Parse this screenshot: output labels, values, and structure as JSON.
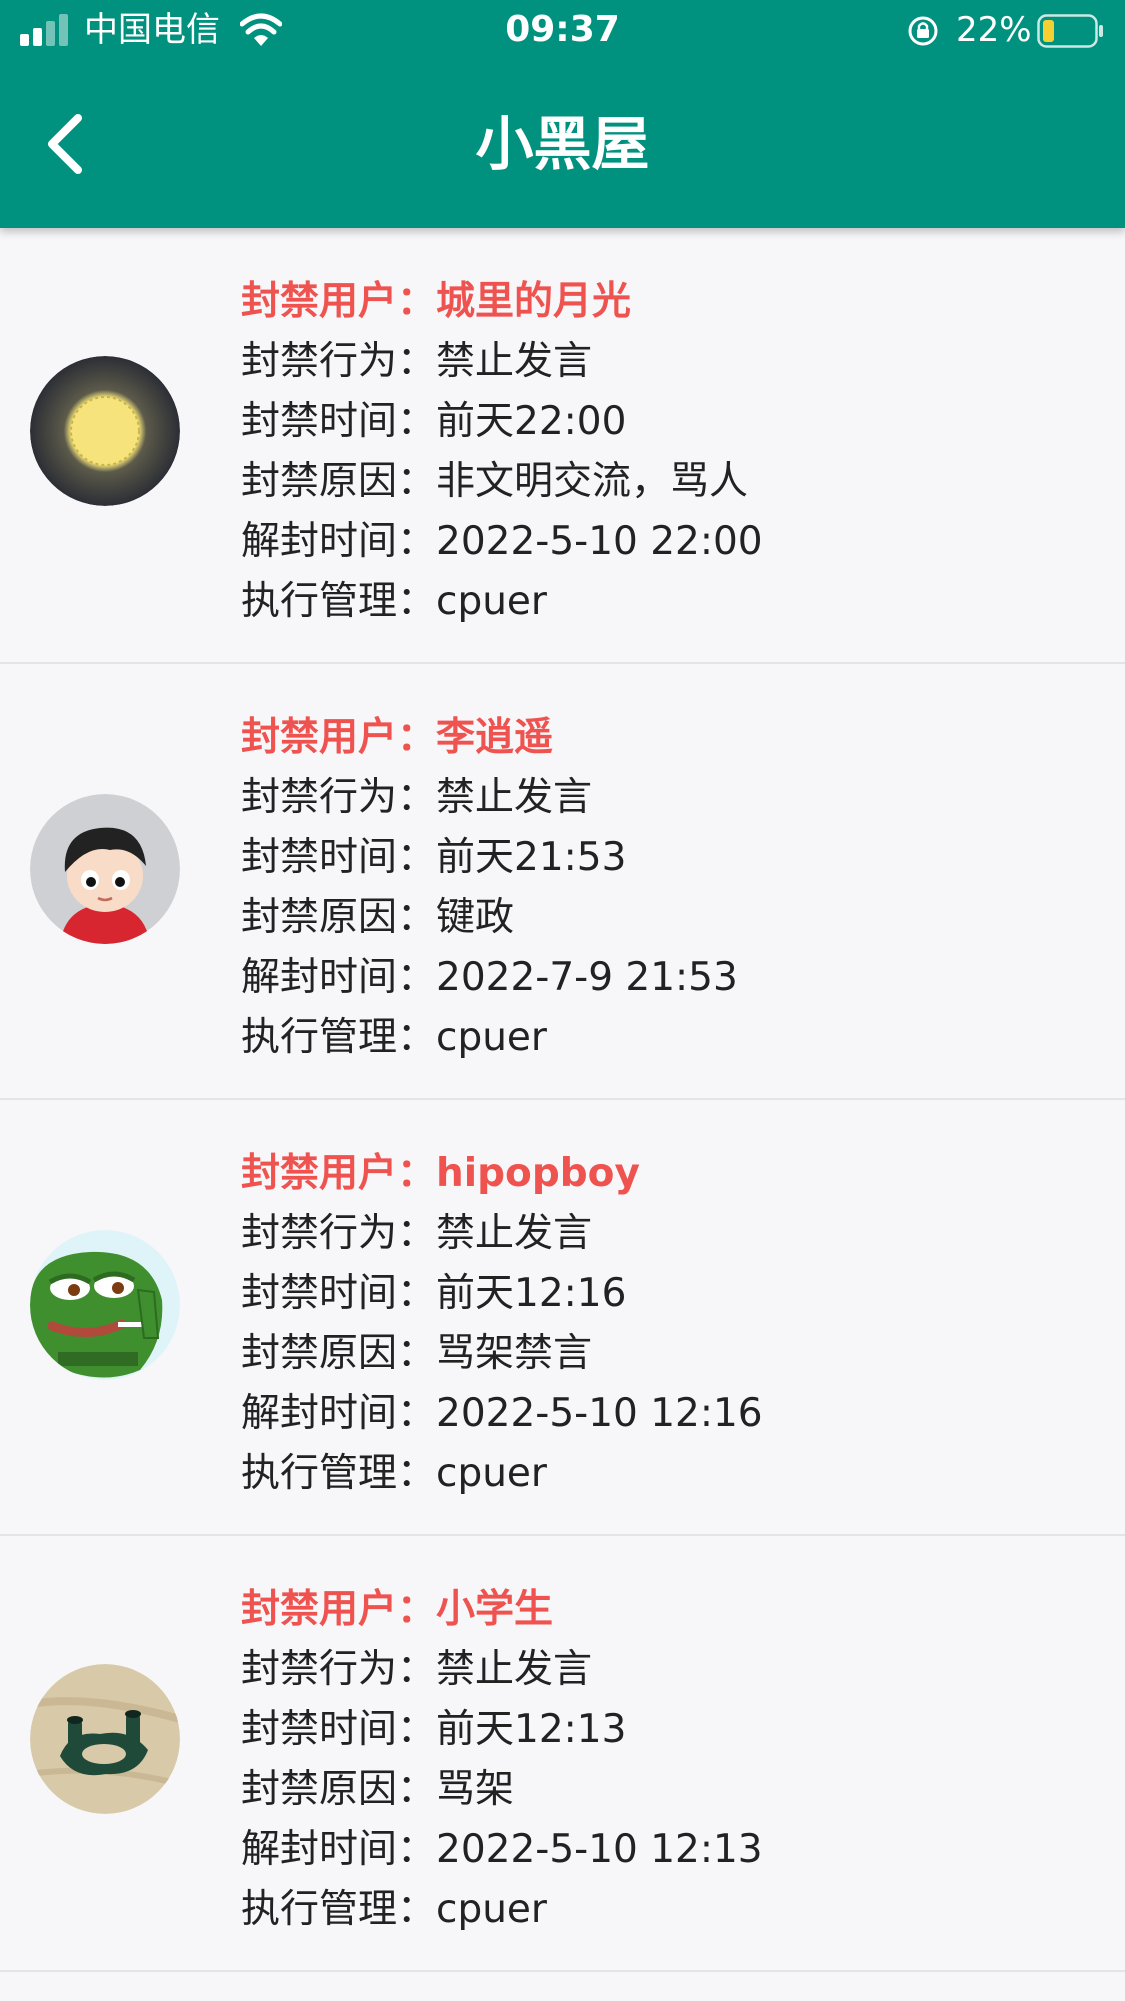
{
  "status_bar": {
    "carrier": "中国电信",
    "time": "09:37",
    "battery_percent": "22%",
    "battery_level": 0.22,
    "icons": [
      "signal-icon",
      "wifi-icon",
      "orientation-lock-icon",
      "battery-icon"
    ]
  },
  "nav": {
    "title": "小黑屋",
    "back_icon": "chevron-left-icon"
  },
  "colors": {
    "header_bg": "#00927f",
    "username_red": "#ef5350",
    "text": "#222222",
    "battery_fill": "#f5d033"
  },
  "bans": [
    {
      "user_line": "封禁用户：城里的月光",
      "action_line": "封禁行为：禁止发言",
      "time_line": "封禁时间：前天22:00",
      "reason_line": "封禁原因：非文明交流，骂人",
      "unban_line": "解封时间：2022-5-10 22:00",
      "admin_line": "执行管理：cpuer",
      "avatar": "moon-avatar"
    },
    {
      "user_line": "封禁用户：李逍遥",
      "action_line": "封禁行为：禁止发言",
      "time_line": "封禁时间：前天21:53",
      "reason_line": "封禁原因：键政",
      "unban_line": "解封时间：2022-7-9 21:53",
      "admin_line": "执行管理：cpuer",
      "avatar": "cartoon-boy-avatar"
    },
    {
      "user_line": "封禁用户：hipopboy",
      "action_line": "封禁行为：禁止发言",
      "time_line": "封禁时间：前天12:16",
      "reason_line": "封禁原因：骂架禁言",
      "unban_line": "解封时间：2022-5-10 12:16",
      "admin_line": "执行管理：cpuer",
      "avatar": "frog-meme-avatar"
    },
    {
      "user_line": "封禁用户：小学生",
      "action_line": "封禁行为：禁止发言",
      "time_line": "封禁时间：前天12:13",
      "reason_line": "封禁原因：骂架",
      "unban_line": "解封时间：2022-5-10 12:13",
      "admin_line": "执行管理：cpuer",
      "avatar": "plastic-part-avatar"
    }
  ]
}
